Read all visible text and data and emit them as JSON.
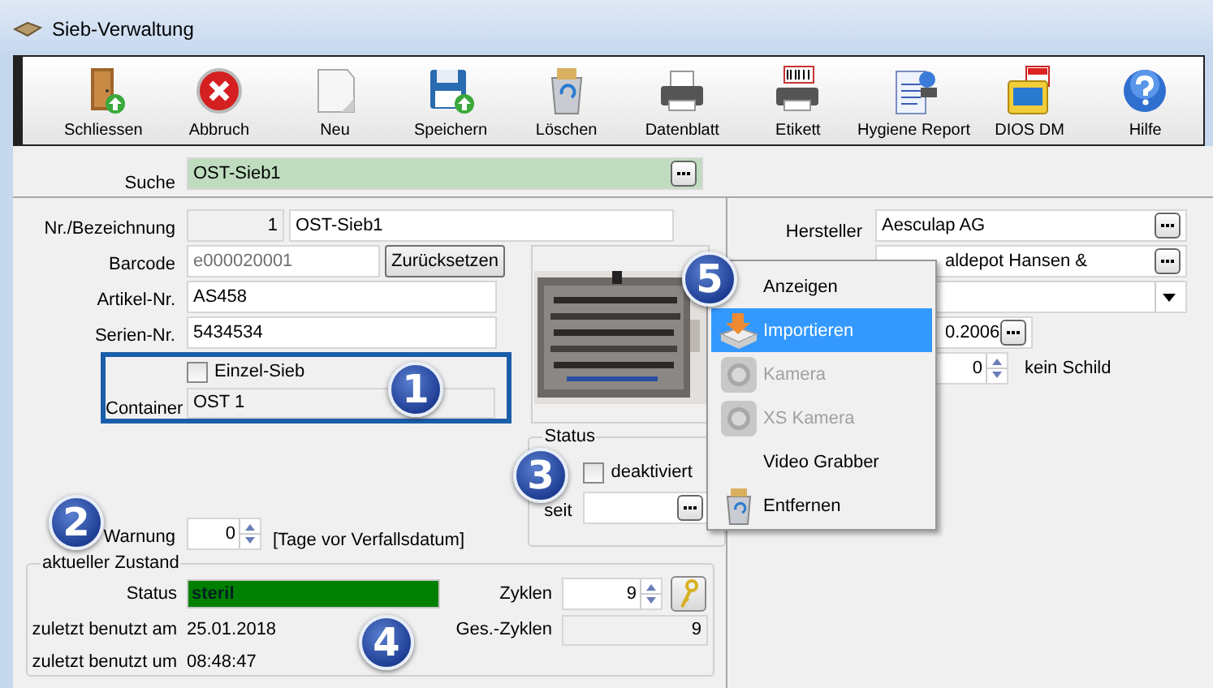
{
  "window": {
    "title": "Sieb-Verwaltung"
  },
  "toolbar": [
    {
      "label": "Schliessen",
      "kind": "door"
    },
    {
      "label": "Abbruch",
      "kind": "cancel"
    },
    {
      "label": "Neu",
      "kind": "page"
    },
    {
      "label": "Speichern",
      "kind": "save"
    },
    {
      "label": "Löschen",
      "kind": "trash"
    },
    {
      "label": "Datenblatt",
      "kind": "printer"
    },
    {
      "label": "Etikett",
      "kind": "label"
    },
    {
      "label": "Hygiene Report",
      "kind": "report"
    },
    {
      "label": "DIOS DM",
      "kind": "qm"
    },
    {
      "label": "Hilfe",
      "kind": "help"
    }
  ],
  "search": {
    "label": "Suche",
    "value": "OST-Sieb1"
  },
  "form": {
    "number": {
      "label": "Nr./Bezeichnung",
      "value": "1"
    },
    "name": {
      "value": "OST-Sieb1"
    },
    "barcode": {
      "label": "Barcode",
      "value": "e000020001",
      "button": "Zurücksetzen"
    },
    "article": {
      "label": "Artikel-Nr.",
      "value": "AS458"
    },
    "serial": {
      "label": "Serien-Nr.",
      "value": "5434534"
    },
    "single": {
      "label": "Einzel-Sieb",
      "checked": false
    },
    "container": {
      "label": "Container",
      "value": "OST 1"
    }
  },
  "status_group": {
    "title": "Status",
    "deactivated": {
      "label": "deaktiviert",
      "checked": false
    },
    "since": {
      "label": "seit"
    }
  },
  "warning": {
    "label": "Warnung",
    "value": "0",
    "hint": "[Tage vor Verfallsdatum]"
  },
  "current": {
    "title": "aktueller Zustand",
    "status": {
      "label": "Status",
      "value": "steril"
    },
    "cycles": {
      "label": "Zyklen",
      "value": "9"
    },
    "last_date": {
      "label": "zuletzt benutzt am",
      "value": "25.01.2018"
    },
    "total_cycles": {
      "label": "Ges.-Zyklen",
      "value": "9"
    },
    "last_time": {
      "label": "zuletzt benutzt um",
      "value": "08:48:47"
    }
  },
  "right": {
    "manufacturer": {
      "label": "Hersteller",
      "value": "Aesculap AG"
    },
    "supplier": {
      "value": "aldepot Hansen &"
    },
    "date": {
      "value": "0.2006"
    },
    "plate": {
      "value": "0",
      "note": "kein Schild"
    }
  },
  "context_menu": [
    {
      "label": "Anzeigen",
      "kind": "plain",
      "selected": false,
      "disabled": false
    },
    {
      "label": "Importieren",
      "kind": "import",
      "selected": true,
      "disabled": false
    },
    {
      "label": "Kamera",
      "kind": "camera",
      "selected": false,
      "disabled": true
    },
    {
      "label": "XS Kamera",
      "kind": "camera",
      "selected": false,
      "disabled": true
    },
    {
      "label": "Video Grabber",
      "kind": "plain",
      "selected": false,
      "disabled": false
    },
    {
      "label": "Entfernen",
      "kind": "delete",
      "selected": false,
      "disabled": false
    }
  ],
  "badges": [
    "1",
    "2",
    "3",
    "4",
    "5"
  ]
}
